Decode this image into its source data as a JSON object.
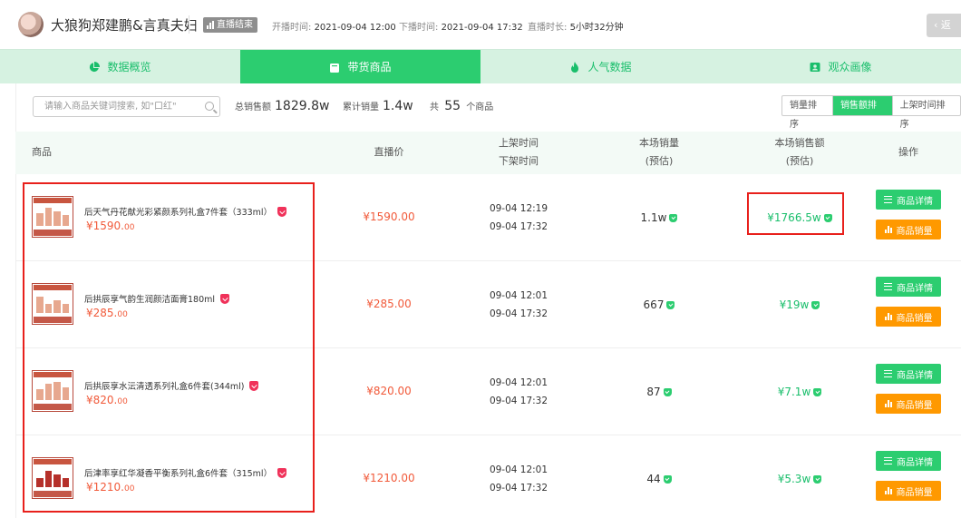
{
  "header": {
    "anchor_name": "大狼狗郑建鹏&言真夫妇",
    "live_status": "直播结束",
    "start_label": "开播时间:",
    "start_value": "2021-09-04 12:00",
    "end_label": "下播时间:",
    "end_value": "2021-09-04 17:32",
    "duration_label": "直播时长:",
    "duration_value": "5小时32分钟",
    "back_label": "返"
  },
  "tabs": [
    {
      "label": "数据概览",
      "icon": "pie-chart-icon",
      "active": false
    },
    {
      "label": "带货商品",
      "icon": "bag-icon",
      "active": true
    },
    {
      "label": "人气数据",
      "icon": "fire-icon",
      "active": false
    },
    {
      "label": "观众画像",
      "icon": "profile-card-icon",
      "active": false
    }
  ],
  "filter": {
    "search_placeholder": "请输入商品关键词搜索, 如\"口红\"",
    "total_sales_label": "总销售额",
    "total_sales_value": "1829.8w",
    "total_volume_label": "累计销量",
    "total_volume_value": "1.4w",
    "count_prefix": "共",
    "count_value": "55",
    "count_suffix": "个商品",
    "sort_options": [
      "销量排序",
      "销售额排序",
      "上架时间排序"
    ],
    "sort_active": "销售额排序"
  },
  "table": {
    "headers": {
      "product": "商品",
      "live_price": "直播价",
      "on_time": "上架时间",
      "off_time": "下架时间",
      "volume": "本场销量",
      "volume_sub": "(预估)",
      "amount": "本场销售额",
      "amount_sub": "(预估)",
      "ops": "操作"
    },
    "rows": [
      {
        "name": "后天气丹花献光彩紧颜系列礼盒7件套（333ml）",
        "price_main": "¥1590.",
        "price_cents": "00",
        "live_price": "¥1590.00",
        "on": "09-04 12:19",
        "off": "09-04 17:32",
        "volume": "1.1w",
        "amount": "¥1766.5w"
      },
      {
        "name": "后拱辰享气韵生润颜洁面膏180ml",
        "price_main": "¥285.",
        "price_cents": "00",
        "live_price": "¥285.00",
        "on": "09-04 12:01",
        "off": "09-04 17:32",
        "volume": "667",
        "amount": "¥19w"
      },
      {
        "name": "后拱辰享水沄清透系列礼盒6件套(344ml)",
        "price_main": "¥820.",
        "price_cents": "00",
        "live_price": "¥820.00",
        "on": "09-04 12:01",
        "off": "09-04 17:32",
        "volume": "87",
        "amount": "¥7.1w"
      },
      {
        "name": "后津率享红华凝香平衡系列礼盒6件套（315ml）",
        "price_main": "¥1210.",
        "price_cents": "00",
        "live_price": "¥1210.00",
        "on": "09-04 12:01",
        "off": "09-04 17:32",
        "volume": "44",
        "amount": "¥5.3w"
      }
    ],
    "detail_label": "商品详情",
    "sales_label": "商品销量"
  },
  "colors": {
    "accent_green": "#2ccd70",
    "tab_bg": "#d6f2e1",
    "price_red": "#f15a3a",
    "amount_green": "#19be6b",
    "orange": "#ff9900",
    "highlight_red": "#e8201c"
  }
}
